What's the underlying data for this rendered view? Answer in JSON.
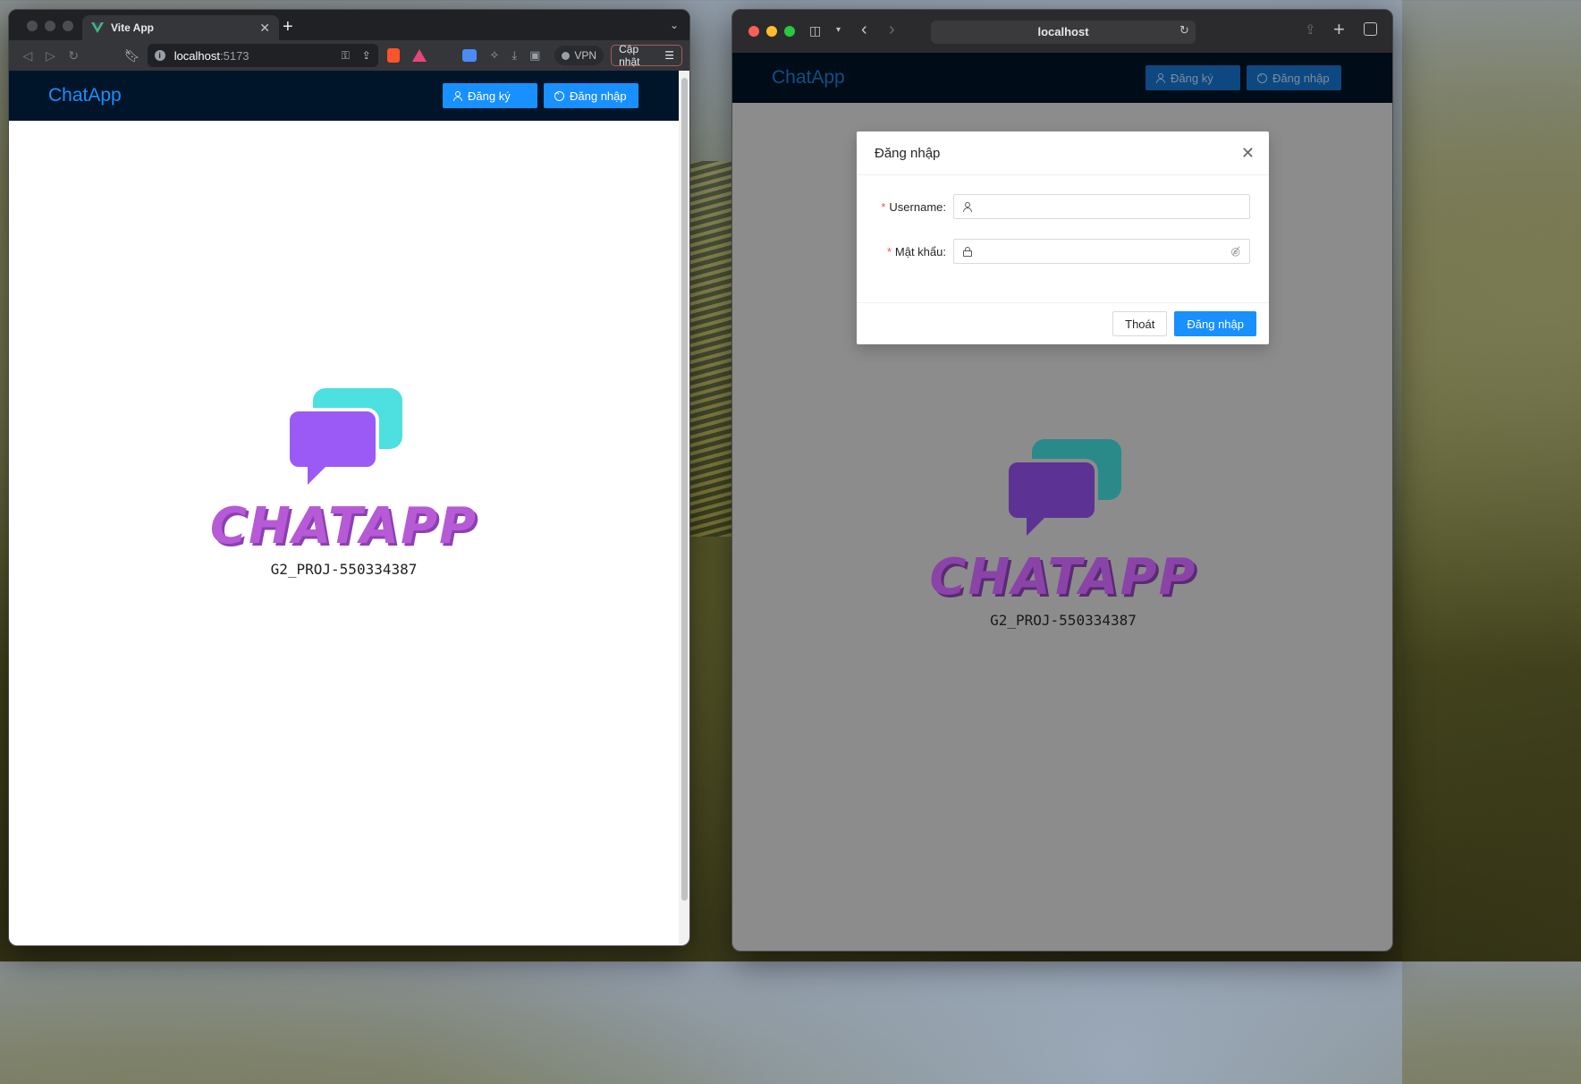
{
  "left_window": {
    "tab_title": "Vite App",
    "url_host": "localhost",
    "url_port": ":5173",
    "vpn_label": "VPN",
    "update_label": "Cập nhật"
  },
  "right_window": {
    "url": "localhost"
  },
  "app": {
    "brand": "ChatApp",
    "register_label": "Đăng ký",
    "login_label": "Đăng nhập",
    "logo_text": "CHATAPP",
    "project_code": "G2_PROJ-550334387"
  },
  "login_modal": {
    "title": "Đăng nhập",
    "username_label": "Username",
    "password_label": "Mật khẩu",
    "cancel_label": "Thoát",
    "submit_label": "Đăng nhập"
  },
  "colors": {
    "primary": "#1890ff",
    "header_bg": "#001529",
    "bubble_teal": "#4de0e0",
    "bubble_purple": "#9b59f5",
    "logo_purple": "#b65ad6"
  },
  "icons": {
    "register": "user-icon",
    "login": "login-icon",
    "username_field": "user-icon",
    "password_field": "lock-icon",
    "password_toggle": "eye-invisible-icon",
    "modal_close": "close-icon"
  }
}
